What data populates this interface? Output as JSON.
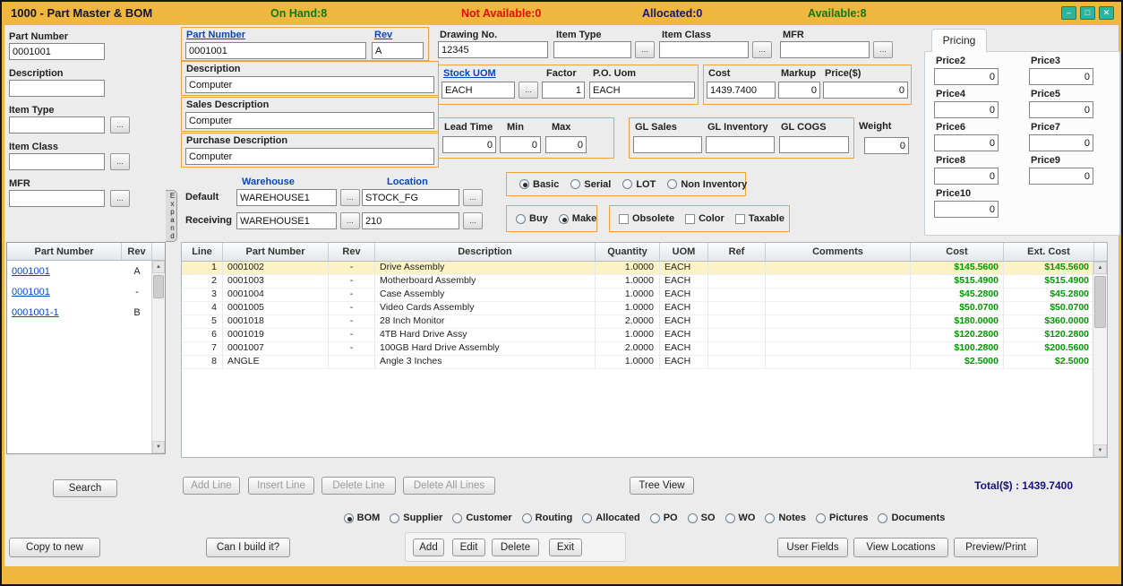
{
  "colors": {
    "titlebar": "#EFB73E",
    "group_border": "#F0A240",
    "label_blue": "#0847C2",
    "money_green": "#009900",
    "status_green": "#0E7A12",
    "status_red": "#E01000",
    "status_navy": "#14147A",
    "selected_row": "#FBF3C5"
  },
  "titlebar": {
    "title": "1000 - Part Master & BOM",
    "on_hand": "On Hand:8",
    "not_available": "Not Available:0",
    "allocated": "Allocated:0",
    "available": "Available:8",
    "minimize": "–",
    "maximize": "□",
    "close": "✕"
  },
  "ui": {
    "lookup": "...",
    "scroll_up": "▲",
    "scroll_down": "▼"
  },
  "search_panel": {
    "part_number_label": "Part Number",
    "part_number_value": "0001001",
    "description_label": "Description",
    "description_value": "",
    "item_type_label": "Item Type",
    "item_type_value": "",
    "item_class_label": "Item Class",
    "item_class_value": "",
    "mfr_label": "MFR",
    "mfr_value": "",
    "list_headers": [
      "Part Number",
      "Rev"
    ],
    "list_rows": [
      {
        "part": "0001001",
        "rev": "A"
      },
      {
        "part": "0001001",
        "rev": "-"
      },
      {
        "part": "0001001-1",
        "rev": "B"
      }
    ],
    "search_button": "Search",
    "expand_tab": "Expand"
  },
  "form": {
    "part_number_label": "Part Number",
    "part_number": "0001001",
    "rev_label": "Rev",
    "rev": "A",
    "description_label": "Description",
    "description": "Computer",
    "sales_description_label": "Sales Description",
    "sales_description": "Computer",
    "purchase_description_label": "Purchase Description",
    "purchase_description": "Computer",
    "drawing_no_label": "Drawing No.",
    "drawing_no": "12345",
    "item_type_label": "Item Type",
    "item_type": "",
    "item_class_label": "Item Class",
    "item_class": "",
    "mfr_label": "MFR",
    "mfr": "",
    "stock_uom_label": "Stock UOM",
    "stock_uom": "EACH",
    "factor_label": "Factor",
    "factor": "1",
    "po_uom_label": "P.O. Uom",
    "po_uom": "EACH",
    "cost_label": "Cost",
    "cost": "1439.7400",
    "markup_label": "Markup",
    "markup": "0",
    "price_label": "Price($)",
    "price": "0",
    "lead_time_label": "Lead Time",
    "lead_time": "0",
    "min_label": "Min",
    "min": "0",
    "max_label": "Max",
    "max": "0",
    "gl_sales_label": "GL Sales",
    "gl_sales": "",
    "gl_inventory_label": "GL Inventory",
    "gl_inventory": "",
    "gl_cogs_label": "GL COGS",
    "gl_cogs": "",
    "weight_label": "Weight",
    "weight": "0"
  },
  "pricing": {
    "tab": "Pricing",
    "fields": [
      {
        "label": "Price2",
        "value": "0"
      },
      {
        "label": "Price3",
        "value": "0"
      },
      {
        "label": "Price4",
        "value": "0"
      },
      {
        "label": "Price5",
        "value": "0"
      },
      {
        "label": "Price6",
        "value": "0"
      },
      {
        "label": "Price7",
        "value": "0"
      },
      {
        "label": "Price8",
        "value": "0"
      },
      {
        "label": "Price9",
        "value": "0"
      },
      {
        "label": "Price10",
        "value": "0"
      }
    ]
  },
  "warehouse": {
    "col_warehouse": "Warehouse",
    "col_location": "Location",
    "default_label": "Default",
    "receiving_label": "Receiving",
    "default_warehouse": "WAREHOUSE1",
    "default_location": "STOCK_FG",
    "receiving_warehouse": "WAREHOUSE1",
    "receiving_location": "210"
  },
  "options": {
    "type_radios": [
      {
        "label": "Basic",
        "checked": true
      },
      {
        "label": "Serial",
        "checked": false
      },
      {
        "label": "LOT",
        "checked": false
      },
      {
        "label": "Non Inventory",
        "checked": false
      }
    ],
    "source_radios": [
      {
        "label": "Buy",
        "checked": false
      },
      {
        "label": "Make",
        "checked": true
      }
    ],
    "flags": [
      {
        "label": "Obsolete",
        "checked": false
      },
      {
        "label": "Color",
        "checked": false
      },
      {
        "label": "Taxable",
        "checked": false
      }
    ]
  },
  "bom": {
    "headers": [
      "Line",
      "Part Number",
      "Rev",
      "Description",
      "Quantity",
      "UOM",
      "Ref",
      "Comments",
      "Cost",
      "Ext. Cost"
    ],
    "rows": [
      {
        "line": "1",
        "part": "0001002",
        "rev": "-",
        "desc": "Drive Assembly",
        "qty": "1.0000",
        "uom": "EACH",
        "ref": "",
        "comments": "",
        "cost": "$145.5600",
        "ext_cost": "$145.5600"
      },
      {
        "line": "2",
        "part": "0001003",
        "rev": "-",
        "desc": "Motherboard Assembly",
        "qty": "1.0000",
        "uom": "EACH",
        "ref": "",
        "comments": "",
        "cost": "$515.4900",
        "ext_cost": "$515.4900"
      },
      {
        "line": "3",
        "part": "0001004",
        "rev": "-",
        "desc": "Case Assembly",
        "qty": "1.0000",
        "uom": "EACH",
        "ref": "",
        "comments": "",
        "cost": "$45.2800",
        "ext_cost": "$45.2800"
      },
      {
        "line": "4",
        "part": "0001005",
        "rev": "-",
        "desc": "Video Cards Assembly",
        "qty": "1.0000",
        "uom": "EACH",
        "ref": "",
        "comments": "",
        "cost": "$50.0700",
        "ext_cost": "$50.0700"
      },
      {
        "line": "5",
        "part": "0001018",
        "rev": "-",
        "desc": "28 Inch Monitor",
        "qty": "2.0000",
        "uom": "EACH",
        "ref": "",
        "comments": "",
        "cost": "$180.0000",
        "ext_cost": "$360.0000"
      },
      {
        "line": "6",
        "part": "0001019",
        "rev": "-",
        "desc": "4TB Hard Drive Assy",
        "qty": "1.0000",
        "uom": "EACH",
        "ref": "",
        "comments": "",
        "cost": "$120.2800",
        "ext_cost": "$120.2800"
      },
      {
        "line": "7",
        "part": "0001007",
        "rev": "-",
        "desc": "100GB Hard Drive Assembly",
        "qty": "2.0000",
        "uom": "EACH",
        "ref": "",
        "comments": "",
        "cost": "$100.2800",
        "ext_cost": "$200.5600"
      },
      {
        "line": "8",
        "part": "ANGLE",
        "rev": "",
        "desc": "Angle 3 Inches",
        "qty": "1.0000",
        "uom": "EACH",
        "ref": "",
        "comments": "",
        "cost": "$2.5000",
        "ext_cost": "$2.5000"
      }
    ],
    "buttons": {
      "add_line": "Add Line",
      "insert_line": "Insert Line",
      "delete_line": "Delete Line",
      "delete_all": "Delete All Lines",
      "tree_view": "Tree View"
    },
    "total": "Total($) : 1439.7400"
  },
  "nav_tabs": {
    "items": [
      {
        "label": "BOM",
        "checked": true
      },
      {
        "label": "Supplier",
        "checked": false
      },
      {
        "label": "Customer",
        "checked": false
      },
      {
        "label": "Routing",
        "checked": false
      },
      {
        "label": "Allocated",
        "checked": false
      },
      {
        "label": "PO",
        "checked": false
      },
      {
        "label": "SO",
        "checked": false
      },
      {
        "label": "WO",
        "checked": false
      },
      {
        "label": "Notes",
        "checked": false
      },
      {
        "label": "Pictures",
        "checked": false
      },
      {
        "label": "Documents",
        "checked": false
      }
    ]
  },
  "actions": {
    "copy_to_new": "Copy to new",
    "can_i_build": "Can I build it?",
    "add": "Add",
    "edit": "Edit",
    "delete": "Delete",
    "exit": "Exit",
    "user_fields": "User Fields",
    "view_locations": "View Locations",
    "preview_print": "Preview/Print"
  }
}
